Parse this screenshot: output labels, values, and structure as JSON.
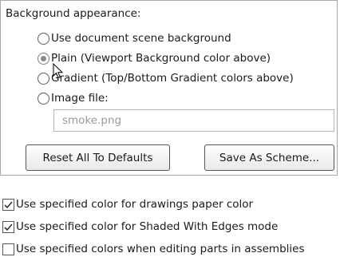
{
  "background_appearance": {
    "title": "Background appearance:",
    "options": [
      {
        "label": "Use document scene background",
        "selected": false
      },
      {
        "label": "Plain (Viewport Background color above)",
        "selected": true
      },
      {
        "label": "Gradient (Top/Bottom Gradient colors above)",
        "selected": false
      },
      {
        "label": "Image file:",
        "selected": false
      }
    ],
    "image_file_value": "smoke.png"
  },
  "buttons": {
    "reset": "Reset All To Defaults",
    "save_scheme": "Save As Scheme..."
  },
  "checkboxes": [
    {
      "label": "Use specified color for drawings paper color",
      "checked": true
    },
    {
      "label": "Use specified color for Shaded With Edges mode",
      "checked": true
    },
    {
      "label": "Use specified colors when editing parts in assemblies",
      "checked": false
    }
  ],
  "icons": {
    "cursor": "mouse-pointer-icon",
    "checkmark": "checkmark-icon"
  }
}
